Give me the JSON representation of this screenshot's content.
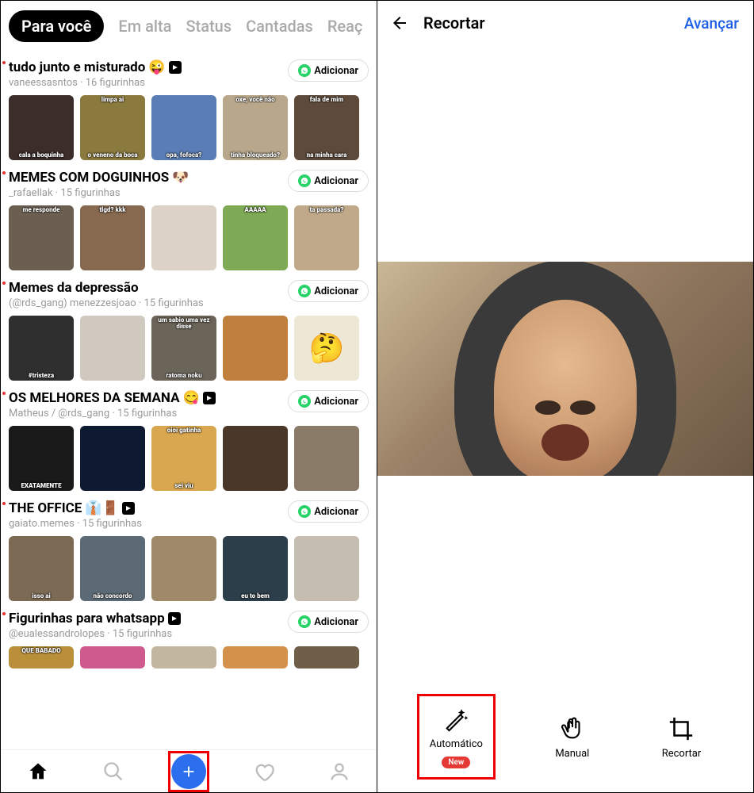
{
  "left": {
    "tabs": [
      "Para você",
      "Em alta",
      "Status",
      "Cantadas",
      "Reaç"
    ],
    "active_tab": 0,
    "add_label": "Adicionar",
    "packs": [
      {
        "title": "tudo junto e misturado",
        "emoji": "😜",
        "has_play": true,
        "subtitle": "vaneessasntos · 16 figurinhas",
        "stickers": [
          {
            "bg": "#3b2d2a",
            "cap_bottom": "cala a boquinha"
          },
          {
            "bg": "#8b7a3e",
            "cap_top": "limpa ai",
            "cap_bottom": "o veneno da boca"
          },
          {
            "bg": "#5a7db5",
            "cap_bottom": "opa, fofoca?"
          },
          {
            "bg": "#b8a78a",
            "cap_top": "oxe, você não",
            "cap_bottom": "tinha bloqueado?"
          },
          {
            "bg": "#5e4a3a",
            "cap_top": "fala de mim",
            "cap_bottom": "na minha cara"
          }
        ]
      },
      {
        "title": "MEMES COM DOGUINHOS",
        "emoji": "🐶",
        "has_play": false,
        "subtitle": "_rafaellak · 15 figurinhas",
        "stickers": [
          {
            "bg": "#6b5f52",
            "cap_top": "me responde"
          },
          {
            "bg": "#87694f",
            "cap_top": "tlgd? kkk"
          },
          {
            "bg": "#dcd2c6"
          },
          {
            "bg": "#7eaa55",
            "cap_top": "AAAAA"
          },
          {
            "bg": "#bfa989",
            "cap_top": "ta passada?"
          }
        ]
      },
      {
        "title": "Memes da depressão",
        "emoji": "",
        "has_play": false,
        "subtitle": "(@rds_gang) menezzesjoao · 15 figurinhas",
        "stickers": [
          {
            "bg": "#2f2f2f",
            "cap_bottom": "#tristeza"
          },
          {
            "bg": "#d0c9c0"
          },
          {
            "bg": "#6b6458",
            "cap_top": "um sabio uma vez disse",
            "cap_bottom": "ratoma noku"
          },
          {
            "bg": "#c17f3e"
          },
          {
            "bg": "#ede7d6",
            "center": "🤔"
          }
        ]
      },
      {
        "title": "OS MELHORES DA SEMANA",
        "emoji": "😋",
        "has_play": true,
        "subtitle": "Matheus / @rds_gang · 15 figurinhas",
        "stickers": [
          {
            "bg": "#1a1a1a",
            "cap_bottom": "EXATAMENTE"
          },
          {
            "bg": "#0e1932"
          },
          {
            "bg": "#d9a74f",
            "cap_top": "oioi gatinha",
            "cap_bottom": "sei viu"
          },
          {
            "bg": "#4a3728"
          },
          {
            "bg": "#8a7a68"
          }
        ]
      },
      {
        "title": "THE OFFICE",
        "emoji": "👔🚪",
        "has_play": true,
        "subtitle": "gaiato.memes · 15 figurinhas",
        "stickers": [
          {
            "bg": "#7d6a55",
            "cap_bottom": "isso ai"
          },
          {
            "bg": "#5c6a75",
            "cap_bottom": "não concordo"
          },
          {
            "bg": "#a08968"
          },
          {
            "bg": "#2c3e4a",
            "cap_bottom": "eu to bem"
          },
          {
            "bg": "#c5beb0"
          }
        ]
      },
      {
        "title": "Figurinhas para whatsapp",
        "emoji": "",
        "has_play": true,
        "subtitle": "@eualessandrolopes · 15 figurinhas",
        "cropped": true,
        "stickers": [
          {
            "bg": "#b98f3a",
            "cap_top": "QUE BABADO"
          },
          {
            "bg": "#cf5a8e"
          },
          {
            "bg": "#c3b6a0"
          },
          {
            "bg": "#d4914c"
          },
          {
            "bg": "#6f5e48"
          }
        ]
      }
    ]
  },
  "right": {
    "title": "Recortar",
    "next": "Avançar",
    "tools": [
      {
        "label": "Automático",
        "new": "New"
      },
      {
        "label": "Manual"
      },
      {
        "label": "Recortar"
      }
    ]
  }
}
